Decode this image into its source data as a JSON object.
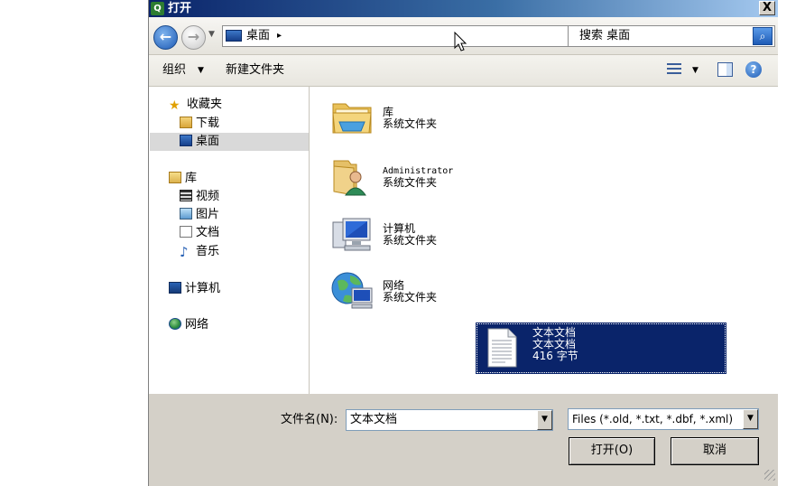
{
  "window": {
    "title": "打开",
    "app_icon": "app-logo-icon",
    "close_glyph": "X"
  },
  "nav": {
    "back_glyph": "←",
    "forward_glyph": "→",
    "address": {
      "icon": "desktop-icon",
      "text": "桌面",
      "crumb_arrow": "▸",
      "dropdown_glyph": "▼"
    },
    "refresh_glyph": "↻",
    "search": {
      "text": "搜索 桌面",
      "button_icon": "search-icon"
    }
  },
  "toolbar": {
    "organize_label": "组织",
    "organize_arrow": "▼",
    "new_folder_label": "新建文件夹",
    "views_arrow": "▼",
    "help_glyph": "?"
  },
  "sidebar": {
    "favorites": {
      "label": "收藏夹",
      "items": [
        {
          "label": "下载"
        },
        {
          "label": "桌面",
          "selected": true
        }
      ]
    },
    "libraries": {
      "label": "库",
      "items": [
        {
          "label": "视频"
        },
        {
          "label": "图片"
        },
        {
          "label": "文档"
        },
        {
          "label": "音乐"
        }
      ]
    },
    "computer": {
      "label": "计算机"
    },
    "network": {
      "label": "网络"
    }
  },
  "files": [
    {
      "name": "库",
      "type": "系统文件夹",
      "icon": "library-folder-icon"
    },
    {
      "name": "Administrator",
      "type": "系统文件夹",
      "icon": "user-folder-icon"
    },
    {
      "name": "计算机",
      "type": "系统文件夹",
      "icon": "computer-icon"
    },
    {
      "name": "网络",
      "type": "系统文件夹",
      "icon": "network-icon"
    },
    {
      "name": "文本文档",
      "type": "文本文档",
      "size": "416 字节",
      "icon": "text-document-icon",
      "selected": true
    }
  ],
  "bottom": {
    "filename_label": "文件名(N):",
    "filename_value": "文本文档",
    "filetype_value": "Files (*.old, *.txt, *.dbf, *.xml)",
    "dropdown_glyph": "▼",
    "open_label": "打开(O)",
    "cancel_label": "取消"
  },
  "colors": {
    "title_bar": "#0a246a",
    "selection": "#0a246a",
    "dialog_face": "#d4d0c8"
  }
}
